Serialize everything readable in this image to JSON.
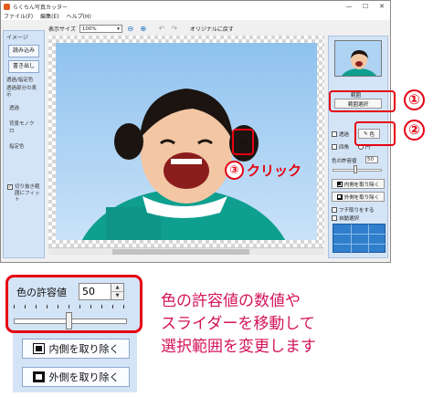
{
  "window": {
    "title": "らくちん写真カッター",
    "controls": [
      "—",
      "☐",
      "✕"
    ],
    "menu": [
      "ファイル(F)",
      "編集(E)",
      "ヘルプ(H)"
    ]
  },
  "toolbar": {
    "display_size_label": "表示サイズ",
    "zoom_value": "100%",
    "original_label": "オリジナルに戻す"
  },
  "left_panel": {
    "heading": "イメージ",
    "load_button": "読み込み",
    "save_button": "書き出し",
    "section_title": "透過/指定色",
    "section_sub": "透過部分の表示",
    "items": [
      "透過",
      "背景モノクロ",
      "指定色"
    ],
    "fit_checkbox": "切り抜き範囲にフィット"
  },
  "right_panel": {
    "label_top": "範囲",
    "range_select_button": "範囲選択",
    "checkbox_transparent": "透過",
    "color_button": "色",
    "radio_rect": "四角",
    "radio_circle": "円",
    "tolerance_label": "色の許容値",
    "tolerance_value": "50",
    "remove_inner": "内側を取り除く",
    "remove_outer": "外側を取り除く",
    "fringe_checkbox": "フチ取りをする",
    "auto_select_checkbox": "自動選択"
  },
  "callouts": {
    "num1": "①",
    "num2": "②",
    "num3": "③",
    "click_text": "クリック"
  },
  "zoom_panel": {
    "tolerance_label": "色の許容値",
    "tolerance_value": "50",
    "slider_level": 0.48,
    "remove_inner": "内側を取り除く",
    "remove_outer": "外側を取り除く"
  },
  "caption": {
    "line1": "色の許容値の数値や",
    "line2": "スライダーを移動して",
    "line3": "選択範囲を変更します"
  },
  "colors": {
    "callout_red": "#e60012",
    "caption_pink": "#d4145a",
    "panel_blue": "#d4e4f7"
  }
}
